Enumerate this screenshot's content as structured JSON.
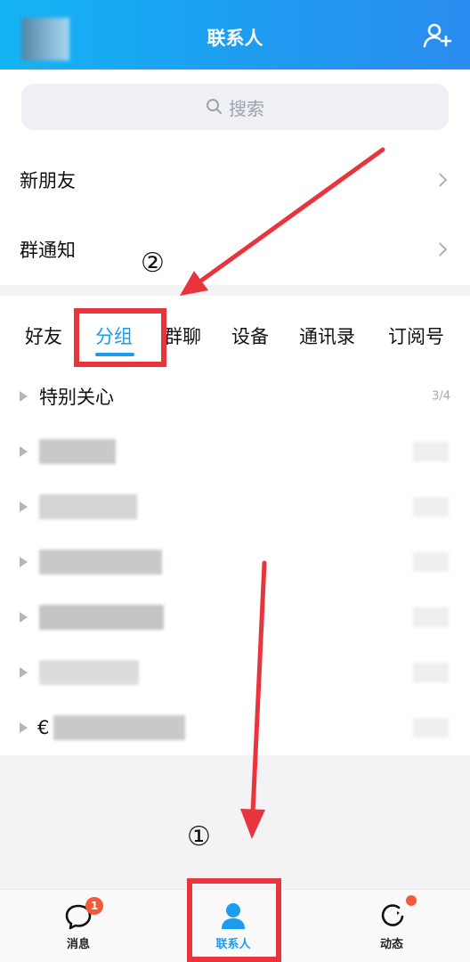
{
  "header": {
    "title": "联系人",
    "add_icon": "add-contact-icon"
  },
  "search": {
    "placeholder": "搜索",
    "icon": "search-icon"
  },
  "menu": [
    {
      "label": "新朋友"
    },
    {
      "label": "群通知"
    }
  ],
  "tabs": [
    {
      "label": "好友",
      "active": false
    },
    {
      "label": "分组",
      "active": true
    },
    {
      "label": "群聊",
      "active": false
    },
    {
      "label": "设备",
      "active": false
    },
    {
      "label": "通讯录",
      "active": false
    },
    {
      "label": "订阅号",
      "active": false
    }
  ],
  "groups": [
    {
      "name": "特别关心",
      "count": "3/4"
    },
    {
      "name": "",
      "blurred": true
    },
    {
      "name": "",
      "blurred": true
    },
    {
      "name": "",
      "blurred": true
    },
    {
      "name": "",
      "blurred": true
    },
    {
      "name": "",
      "blurred": true
    },
    {
      "name": "€",
      "blurred": true
    }
  ],
  "bottom_nav": [
    {
      "label": "消息",
      "icon": "chat-bubble-icon",
      "badge": "1",
      "active": false
    },
    {
      "label": "联系人",
      "icon": "person-icon",
      "active": true
    },
    {
      "label": "动态",
      "icon": "star-refresh-icon",
      "has_dot": true,
      "active": false
    }
  ],
  "annotations": {
    "step1": "①",
    "step2": "②",
    "highlight_color": "#e8343c"
  },
  "colors": {
    "accent": "#1a9cf0",
    "header": "#1e9cf0",
    "badge": "#f15a3a"
  }
}
